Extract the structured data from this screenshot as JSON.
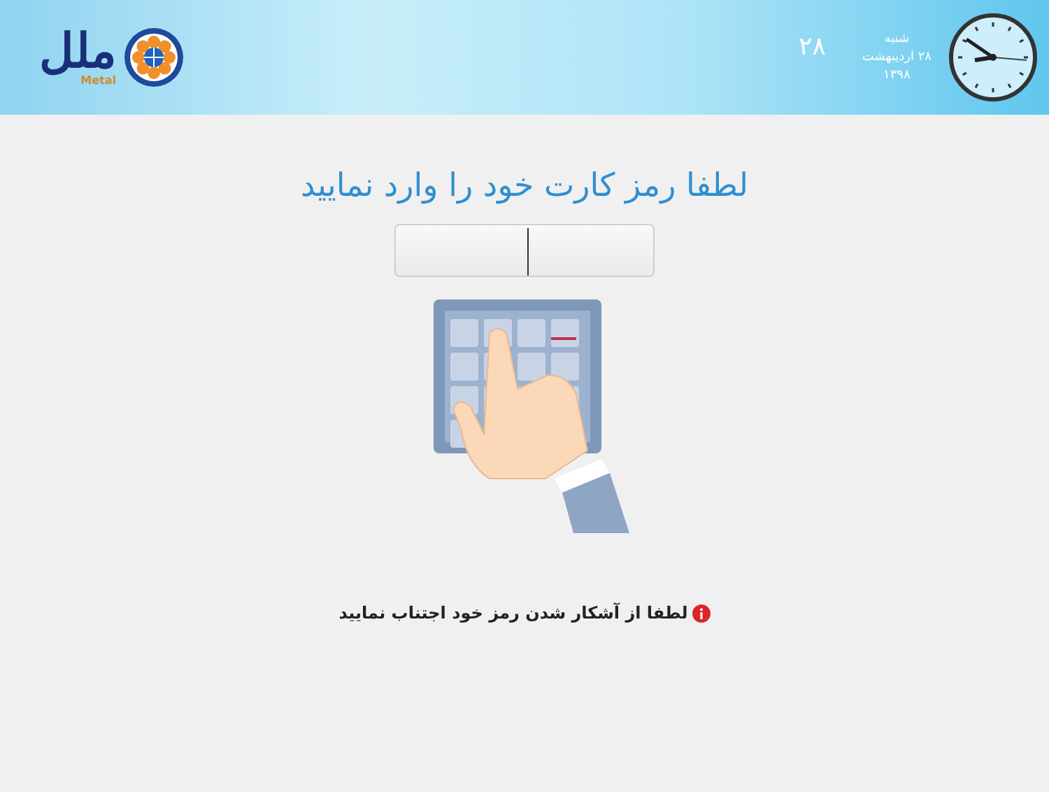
{
  "header": {
    "logo": {
      "wordmark": "ملل",
      "latin": "Metal"
    },
    "day_number": "۲۸",
    "weekday": "شنبه",
    "date": "۲۸ اردیبهشت",
    "year": "۱۳۹۸"
  },
  "prompt": "لطفا رمز کارت خود را وارد نمایید",
  "pin_field": {
    "cursor": true
  },
  "warning": "لطفا از آشکار شدن رمز خود اجتناب نمایید"
}
